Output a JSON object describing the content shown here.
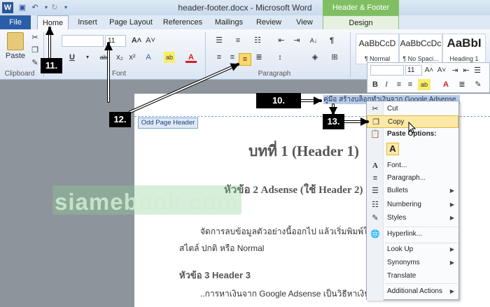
{
  "window": {
    "title": "header-footer.docx - Microsoft Word",
    "contextual_group": "Header & Footer Tools"
  },
  "tabs": [
    "File",
    "Home",
    "Insert",
    "Page Layout",
    "References",
    "Mailings",
    "Review",
    "View",
    "Design"
  ],
  "ribbon": {
    "paste_label": "Paste",
    "font_size": "11",
    "groups": {
      "clipboard": "Clipboard",
      "font": "Font",
      "paragraph": "Paragraph"
    },
    "styles": [
      {
        "sample": "AaBbCcD",
        "name": "¶ Normal"
      },
      {
        "sample": "AaBbCcDc",
        "name": "¶ No Spaci..."
      },
      {
        "sample": "AaBbI",
        "name": "Heading 1"
      }
    ]
  },
  "mini_toolbar": {
    "font_size": "11"
  },
  "document": {
    "header_tab": "Odd Page Header",
    "header_text": "คู่มือ สร้างบล็อกทำเงินจาก Google Adsense",
    "heading1": "บทที่ 1 (Header 1)",
    "heading2": "หัวข้อ 2 Adsense (ใช้ Header 2)",
    "body1": "จัดการลบข้อมูลตัวอย่างนี้ออกไป แล้วเริ่มพิมพ์ใหม่",
    "body2": "สไตล์ ปกติ หรือ Normal",
    "heading3": "หัวข้อ 3 Header 3",
    "body3": "..การหาเงินจาก Google Adsense เป็นวิธีหาเงินบน",
    "watermark": "siamebook.com"
  },
  "context_menu": {
    "items": [
      {
        "icon": "scissors-icon",
        "label": "Cut"
      },
      {
        "icon": "copy-icon",
        "label": "Copy"
      },
      {
        "icon": "clipboard-icon",
        "label": "Paste Options:"
      },
      {
        "icon": "font-icon",
        "label": "Font..."
      },
      {
        "icon": "paragraph-icon",
        "label": "Paragraph..."
      },
      {
        "icon": "bullets-icon",
        "label": "Bullets"
      },
      {
        "icon": "numbering-icon",
        "label": "Numbering"
      },
      {
        "icon": "styles-icon",
        "label": "Styles"
      },
      {
        "icon": "hyperlink-icon",
        "label": "Hyperlink..."
      },
      {
        "icon": "",
        "label": "Look Up"
      },
      {
        "icon": "",
        "label": "Synonyms"
      },
      {
        "icon": "",
        "label": "Translate"
      },
      {
        "icon": "",
        "label": "Additional Actions"
      }
    ]
  },
  "callouts": [
    "11.",
    "12.",
    "13.",
    "10."
  ]
}
